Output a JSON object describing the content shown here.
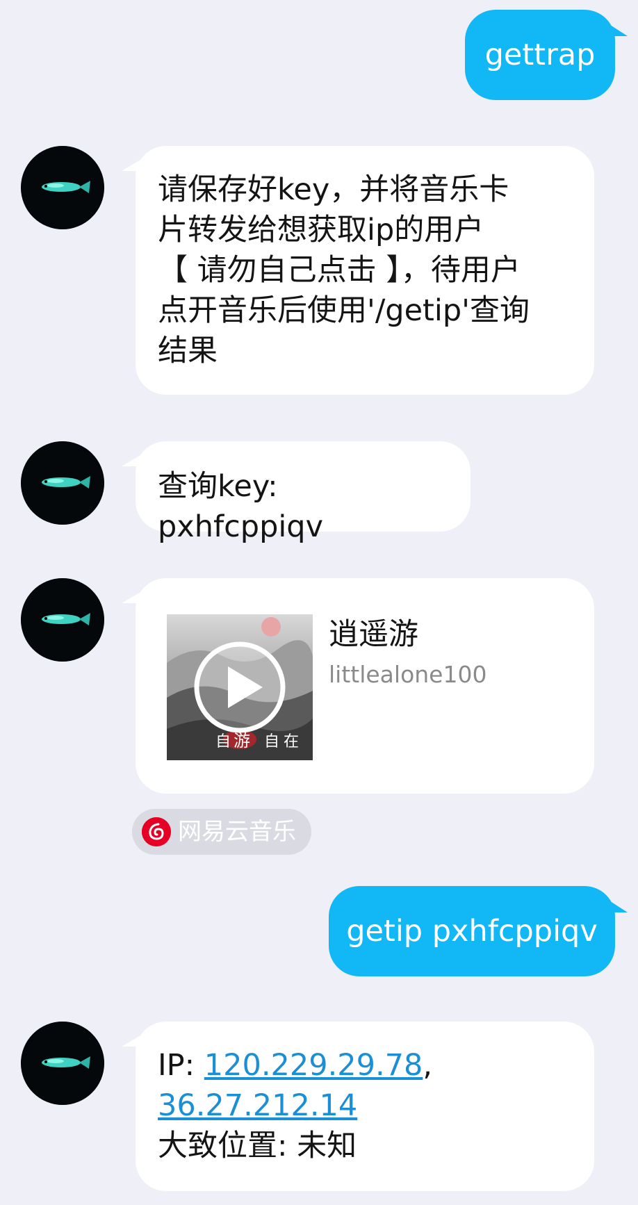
{
  "colors": {
    "background": "#eff0f7",
    "outgoing_bubble": "#12b7f5",
    "incoming_bubble": "#ffffff",
    "link": "#1b8fd6",
    "netease_red": "#e60026"
  },
  "messages": [
    {
      "direction": "outgoing",
      "text": "gettrap"
    },
    {
      "direction": "incoming",
      "avatar_icon": "fish-avatar-icon",
      "lines": [
        "请保存好key，并将音乐卡",
        "片转发给想获取ip的用户",
        "【 请勿自己点击 】，待用户",
        "点开音乐后使用'/getip'查询",
        "结果"
      ]
    },
    {
      "direction": "incoming",
      "avatar_icon": "fish-avatar-icon",
      "text": "查询key: pxhfcppiqv"
    },
    {
      "direction": "incoming",
      "avatar_icon": "fish-avatar-icon",
      "music_card": {
        "title": "逍遥游",
        "artist": "littlealone100",
        "cover_icon": "play-icon",
        "cover_caption": [
          "自",
          "游",
          "自",
          "在"
        ],
        "source": {
          "icon": "netease-music-icon",
          "label": "网易云音乐"
        }
      }
    },
    {
      "direction": "outgoing",
      "text": "getip pxhfcppiqv"
    },
    {
      "direction": "incoming",
      "avatar_icon": "fish-avatar-icon",
      "ip_label": "IP: ",
      "ips": [
        "120.229.29.78",
        "36.27.212.14"
      ],
      "separator": ",",
      "location_line": "大致位置: 未知"
    }
  ]
}
